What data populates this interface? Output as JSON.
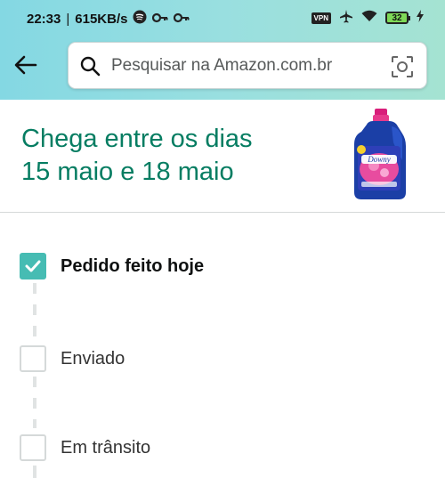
{
  "status_bar": {
    "time": "22:33",
    "network_speed": "615KB/s",
    "vpn_badge": "VPN",
    "battery": "32"
  },
  "header": {
    "search_placeholder": "Pesquisar na Amazon.com.br"
  },
  "delivery": {
    "line1": "Chega entre os dias",
    "line2": "15 maio e 18 maio"
  },
  "product": {
    "brand_text": "Downy"
  },
  "timeline": [
    {
      "label": "Pedido feito hoje",
      "checked": true
    },
    {
      "label": "Enviado",
      "checked": false
    },
    {
      "label": "Em trânsito",
      "checked": false
    }
  ],
  "colors": {
    "header_gradient_start": "#84d8e3",
    "header_gradient_end": "#a5e3d2",
    "delivery_text": "#067d62",
    "check_teal": "#46bcb3"
  },
  "icons": [
    "back-arrow-icon",
    "search-icon",
    "camera-scan-icon",
    "spotify-icon",
    "key-icon",
    "airplane-icon",
    "wifi-icon",
    "charging-icon",
    "check-icon"
  ]
}
